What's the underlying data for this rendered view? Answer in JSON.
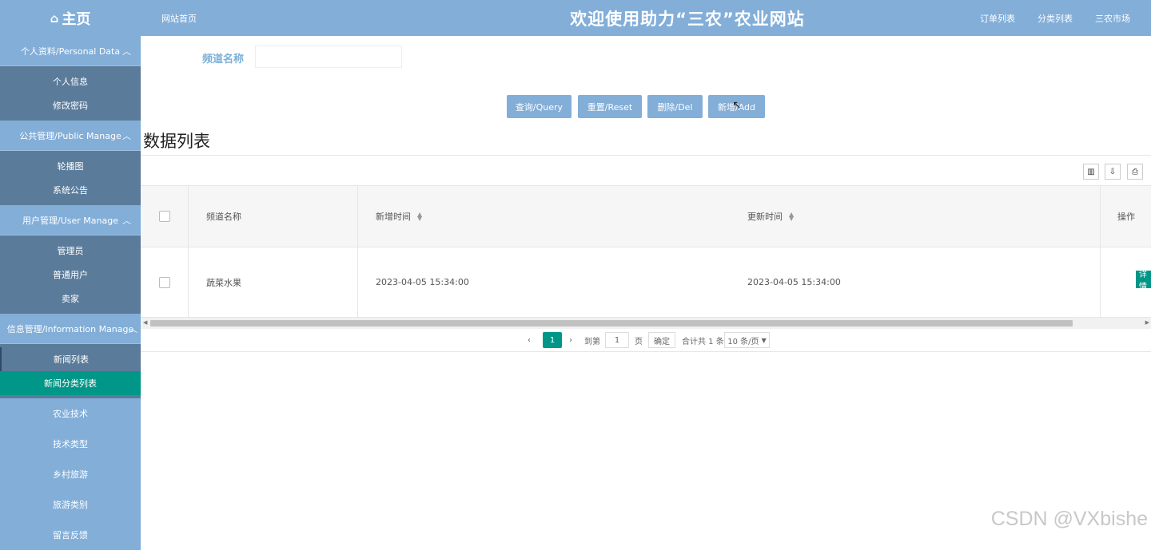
{
  "header": {
    "home_label": "主页",
    "home_icon": "house-icon",
    "site_link": "网站首页",
    "title": "欢迎使用助力“三农”农业网站",
    "right_links": [
      "订单列表",
      "分类列表",
      "三农市场"
    ]
  },
  "sidebar": {
    "groups": [
      {
        "label": "个人资料/Personal Data",
        "items": [
          "个人信息",
          "修改密码"
        ]
      },
      {
        "label": "公共管理/Public Manage",
        "items": [
          "轮播图",
          "系统公告"
        ]
      },
      {
        "label": "用户管理/User Manage",
        "items": [
          "管理员",
          "普通用户",
          "卖家"
        ]
      },
      {
        "label": "信息管理/Information Manage",
        "items": [
          "新闻列表",
          "新闻分类列表"
        ]
      }
    ],
    "loose_items": [
      "农业技术",
      "技术类型",
      "乡村旅游",
      "旅游类别",
      "留言反馈"
    ]
  },
  "search": {
    "label": "频道名称",
    "value": "",
    "buttons": [
      "查询/Query",
      "重置/Reset",
      "删除/Del",
      "新增/Add"
    ]
  },
  "list": {
    "title": "数据列表",
    "columns": [
      "频道名称",
      "新增时间",
      "更新时间",
      "操作"
    ],
    "rows": [
      {
        "name": "蔬菜水果",
        "created": "2023-04-05 15:34:00",
        "updated": "2023-04-05 15:34:00",
        "action": "详情"
      }
    ],
    "tools": [
      "columns-icon",
      "export-icon",
      "print-icon"
    ]
  },
  "pagination": {
    "current": "1",
    "goto_label": "到第",
    "goto_value": "1",
    "page_unit": "页",
    "confirm": "确定",
    "total": "合计共 1 条",
    "per_page": "10 条/页"
  },
  "watermark": "CSDN @VXbishe",
  "colors": {
    "primary": "#82aed8",
    "accent": "#009688",
    "submenu": "#5b7b9a"
  }
}
